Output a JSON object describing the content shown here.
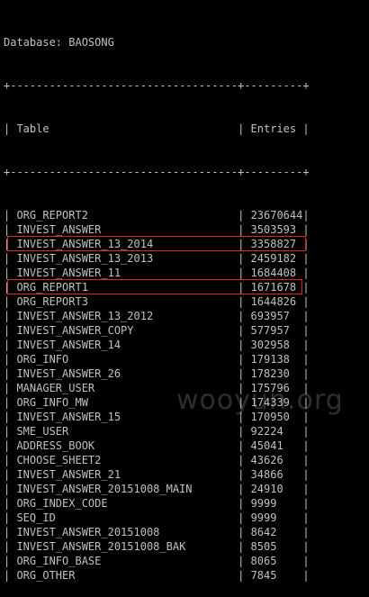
{
  "database_line": "Database: BAOSONG",
  "border_top": "+-----------------------------------+---------+",
  "border_mid": "+-----------------------------------+---------+",
  "header": {
    "table_label": "Table",
    "entries_label": "Entries"
  },
  "rows": [
    {
      "table": "ORG_REPORT2",
      "entries": "23670644"
    },
    {
      "table": "INVEST_ANSWER",
      "entries": "3503593"
    },
    {
      "table": "INVEST_ANSWER_13_2014",
      "entries": "3358827"
    },
    {
      "table": "INVEST_ANSWER_13_2013",
      "entries": "2459182"
    },
    {
      "table": "INVEST_ANSWER_11",
      "entries": "1684408"
    },
    {
      "table": "ORG_REPORT1",
      "entries": "1671678"
    },
    {
      "table": "ORG_REPORT3",
      "entries": "1644826"
    },
    {
      "table": "INVEST_ANSWER_13_2012",
      "entries": "693957"
    },
    {
      "table": "INVEST_ANSWER_COPY",
      "entries": "577957"
    },
    {
      "table": "INVEST_ANSWER_14",
      "entries": "302958"
    },
    {
      "table": "ORG_INFO",
      "entries": "179138"
    },
    {
      "table": "INVEST_ANSWER_26",
      "entries": "178230"
    },
    {
      "table": "MANAGER_USER",
      "entries": "175796"
    },
    {
      "table": "ORG_INFO_MW",
      "entries": "174339"
    },
    {
      "table": "INVEST_ANSWER_15",
      "entries": "170950"
    },
    {
      "table": "SME_USER",
      "entries": "92224"
    },
    {
      "table": "ADDRESS_BOOK",
      "entries": "45041"
    },
    {
      "table": "CHOOSE_SHEET2",
      "entries": "43626"
    },
    {
      "table": "INVEST_ANSWER_21",
      "entries": "34866"
    },
    {
      "table": "INVEST_ANSWER_20151008_MAIN",
      "entries": "24910"
    },
    {
      "table": "ORG_INDEX_CODE",
      "entries": "9999"
    },
    {
      "table": "SEQ_ID",
      "entries": "9999"
    },
    {
      "table": "INVEST_ANSWER_20151008",
      "entries": "8642"
    },
    {
      "table": "INVEST_ANSWER_20151008_BAK",
      "entries": "8505"
    },
    {
      "table": "ORG_INFO_BASE",
      "entries": "8065"
    },
    {
      "table": "ORG_OTHER",
      "entries": "7845"
    }
  ],
  "watermark": "wooyun.org",
  "colors": {
    "background": "#000000",
    "text": "#c0c0c0",
    "highlight": "#e02424"
  }
}
